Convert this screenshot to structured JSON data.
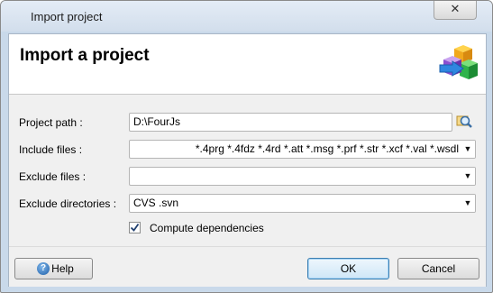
{
  "window": {
    "title": "Import project",
    "close_glyph": "✕"
  },
  "header": {
    "title": "Import a project",
    "logo_icon": "import-boxes-icon"
  },
  "form": {
    "project_path": {
      "label": "Project path :",
      "value": "D:\\FourJs"
    },
    "include_files": {
      "label": "Include files :",
      "value": " *.4prg *.4fdz *.4rd *.att *.msg *.prf *.str *.xcf *.val *.wsdl"
    },
    "exclude_files": {
      "label": "Exclude files :",
      "value": ""
    },
    "exclude_directories": {
      "label": "Exclude directories :",
      "value": "CVS .svn"
    },
    "compute_dependencies": {
      "label": "Compute dependencies",
      "checked": true
    }
  },
  "buttons": {
    "help": "Help",
    "ok": "OK",
    "cancel": "Cancel"
  },
  "glyphs": {
    "combo_arrow": "▼",
    "check": "✔",
    "help": "?"
  }
}
